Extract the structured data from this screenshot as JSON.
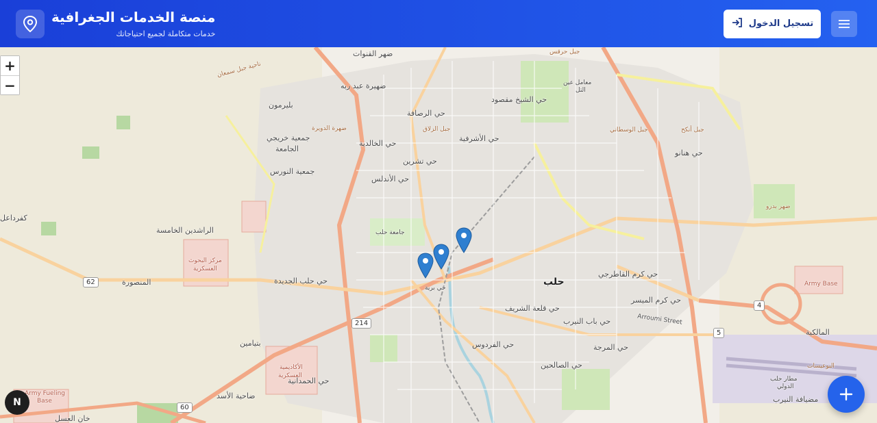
{
  "header": {
    "title": "منصة الخدمات الجغرافية",
    "subtitle": "خدمات متكاملة لجميع احتياجاتك",
    "brand_icon": "map-pin-icon",
    "login_label": "تسجيل الدخول",
    "login_icon": "login-arrow-icon",
    "menu_icon": "hamburger-menu-icon",
    "colors": {
      "header_start": "#1a3fd8",
      "header_end": "#2461f0",
      "accent": "#2563eb",
      "marker": "#2f7fd0"
    }
  },
  "map": {
    "zoom_in": "+",
    "zoom_out": "−",
    "compass_label": "N",
    "fab_icon": "plus-icon",
    "labels": {
      "l1": "ضهر القنوات",
      "l2": "ضهيرة عبد ربه",
      "l3": "بليرمون",
      "l4": "جمعية خريجي",
      "l5": "الجامعة",
      "l6": "ضهرة الدويرة",
      "l7": "جمعية النورس",
      "l8": "الراشدين الخامسة",
      "l9": "كفرداعل",
      "l10": "مركز البحوث",
      "l11": "العسكرية",
      "l12": "المنصورة",
      "l13": "حي حلب الجديدة",
      "l14": "بتيامين",
      "l15": "الأكاديمية",
      "l16": "العسكرية",
      "l17": "حي الحمدانية",
      "l18": "ضاحية الأسد",
      "l19": "Army Fueling",
      "l20": "Base",
      "l21": "خان العسل",
      "l22": "حي الرصافة",
      "l23": "حي الخالدية",
      "l24": "حي تشرين",
      "l25": "حي الأندلس",
      "l26": "جامعة حلب",
      "l27": "حي الشيخ مقصود",
      "l28": "حي الأشرفية",
      "l29": "جبل الزلاق",
      "l30": "معامل عين",
      "l31": "التل",
      "l32": "جبل حرقس",
      "l33": "جبل الوسطاني",
      "l34": "جبل أنكح",
      "l35": "حي هنانو",
      "l36": "ضهر بدرو",
      "l37": "حلب",
      "l38": "حي كرم القاطرجي",
      "l39": "حي كرم الميسر",
      "l40": "حي قلعة الشريف",
      "l41": "حي باب النيرب",
      "l42": "حي المرجة",
      "l43": "حي الفردوس",
      "l44": "حي الصالحين",
      "l45": "Arroumi Street",
      "l46": "Army Base",
      "l47": "المالكية",
      "l48": "البوعيسات",
      "l49": "مطار حلب",
      "l50": "الدولي",
      "l51": "مضيافة النيرب",
      "l52": "حي برية",
      "l53": "ناحية جبل سمعان"
    },
    "shields": {
      "s1": "62",
      "s2": "214",
      "s3": "60",
      "s4": "4",
      "s5": "5"
    },
    "markers": [
      "map-marker-icon",
      "map-marker-icon",
      "map-marker-icon"
    ]
  }
}
